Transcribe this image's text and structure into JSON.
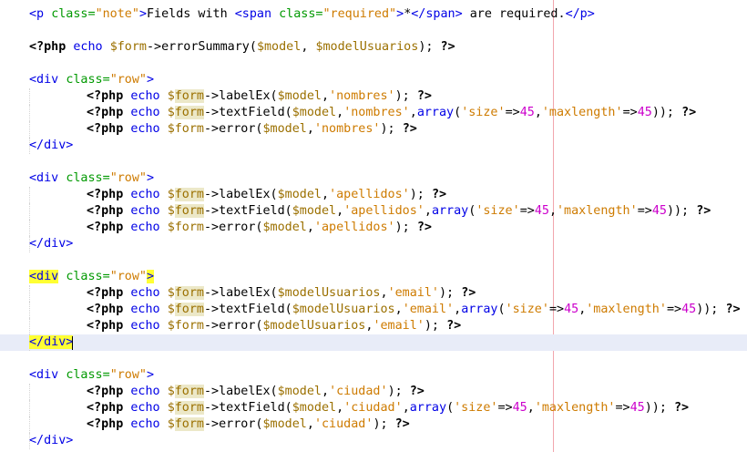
{
  "editor": {
    "lines": [
      {
        "text": "<p class=\"note\">Fields with <span class=\"required\">*</span> are required.</p>",
        "tokens": [
          [
            "t-tag",
            "<p "
          ],
          [
            "t-attr",
            "class="
          ],
          [
            "t-str",
            "\"note\""
          ],
          [
            "t-tag",
            ">"
          ],
          [
            "t-txt",
            "Fields with "
          ],
          [
            "t-tag",
            "<span "
          ],
          [
            "t-attr",
            "class="
          ],
          [
            "t-str",
            "\"required\""
          ],
          [
            "t-tag",
            ">"
          ],
          [
            "t-txt",
            "*"
          ],
          [
            "t-tag",
            "</span>"
          ],
          [
            "t-txt",
            " are required."
          ],
          [
            "t-tag",
            "</p>"
          ]
        ]
      },
      {
        "text": "",
        "tokens": []
      },
      {
        "text": "<?php echo $form->errorSummary($model, $modelUsuarios); ?>",
        "tokens": [
          [
            "t-kw",
            "<?php "
          ],
          [
            "t-fn",
            "echo "
          ],
          [
            "t-var",
            "$form"
          ],
          [
            "t-txt",
            "->errorSummary("
          ],
          [
            "t-var",
            "$model"
          ],
          [
            "t-txt",
            ", "
          ],
          [
            "t-var",
            "$modelUsuarios"
          ],
          [
            "t-txt",
            "); "
          ],
          [
            "t-kw",
            "?>"
          ]
        ]
      },
      {
        "text": "",
        "tokens": []
      },
      {
        "text": "<div class=\"row\">",
        "tokens": [
          [
            "t-tag",
            "<div "
          ],
          [
            "t-attr",
            "class="
          ],
          [
            "t-str",
            "\"row\""
          ],
          [
            "t-tag",
            ">"
          ]
        ]
      },
      {
        "text": "<?php echo $form->labelEx($model,'nombres'); ?>",
        "indent": true,
        "tokens": [
          [
            "t-kw",
            "<?php "
          ],
          [
            "t-fn",
            "echo "
          ],
          [
            "t-var",
            "$"
          ],
          [
            "t-var hl-tan",
            "form"
          ],
          [
            "t-txt",
            "->labelEx("
          ],
          [
            "t-var",
            "$model"
          ],
          [
            "t-txt",
            ","
          ],
          [
            "t-str",
            "'nombres'"
          ],
          [
            "t-txt",
            "); "
          ],
          [
            "t-kw",
            "?>"
          ]
        ]
      },
      {
        "text": "<?php echo $form->textField($model,'nombres',array('size'=>45,'maxlength'=>45)); ?>",
        "indent": true,
        "tokens": [
          [
            "t-kw",
            "<?php "
          ],
          [
            "t-fn",
            "echo "
          ],
          [
            "t-var",
            "$"
          ],
          [
            "t-var hl-tan",
            "form"
          ],
          [
            "t-txt",
            "->textField("
          ],
          [
            "t-var",
            "$model"
          ],
          [
            "t-txt",
            ","
          ],
          [
            "t-str",
            "'nombres'"
          ],
          [
            "t-txt",
            ","
          ],
          [
            "t-arr",
            "array"
          ],
          [
            "t-txt",
            "("
          ],
          [
            "t-str",
            "'size'"
          ],
          [
            "t-txt",
            "=>"
          ],
          [
            "t-num",
            "45"
          ],
          [
            "t-txt",
            ","
          ],
          [
            "t-str",
            "'maxlength'"
          ],
          [
            "t-txt",
            "=>"
          ],
          [
            "t-num",
            "45"
          ],
          [
            "t-txt",
            ")); "
          ],
          [
            "t-kw",
            "?>"
          ]
        ]
      },
      {
        "text": "<?php echo $form->error($model,'nombres'); ?>",
        "indent": true,
        "tokens": [
          [
            "t-kw",
            "<?php "
          ],
          [
            "t-fn",
            "echo "
          ],
          [
            "t-var",
            "$form"
          ],
          [
            "t-txt",
            "->error("
          ],
          [
            "t-var",
            "$model"
          ],
          [
            "t-txt",
            ","
          ],
          [
            "t-str",
            "'nombres'"
          ],
          [
            "t-txt",
            "); "
          ],
          [
            "t-kw",
            "?>"
          ]
        ]
      },
      {
        "text": "</div>",
        "tokens": [
          [
            "t-tag",
            "</div>"
          ]
        ]
      },
      {
        "text": "",
        "tokens": []
      },
      {
        "text": "<div class=\"row\">",
        "tokens": [
          [
            "t-tag",
            "<div "
          ],
          [
            "t-attr",
            "class="
          ],
          [
            "t-str",
            "\"row\""
          ],
          [
            "t-tag",
            ">"
          ]
        ]
      },
      {
        "text": "<?php echo $form->labelEx($model,'apellidos'); ?>",
        "indent": true,
        "tokens": [
          [
            "t-kw",
            "<?php "
          ],
          [
            "t-fn",
            "echo "
          ],
          [
            "t-var",
            "$"
          ],
          [
            "t-var hl-tan",
            "form"
          ],
          [
            "t-txt",
            "->labelEx("
          ],
          [
            "t-var",
            "$model"
          ],
          [
            "t-txt",
            ","
          ],
          [
            "t-str",
            "'apellidos'"
          ],
          [
            "t-txt",
            "); "
          ],
          [
            "t-kw",
            "?>"
          ]
        ]
      },
      {
        "text": "<?php echo $form->textField($model,'apellidos',array('size'=>45,'maxlength'=>45)); ?>",
        "indent": true,
        "tokens": [
          [
            "t-kw",
            "<?php "
          ],
          [
            "t-fn",
            "echo "
          ],
          [
            "t-var",
            "$"
          ],
          [
            "t-var hl-tan",
            "form"
          ],
          [
            "t-txt",
            "->textField("
          ],
          [
            "t-var",
            "$model"
          ],
          [
            "t-txt",
            ","
          ],
          [
            "t-str",
            "'apellidos'"
          ],
          [
            "t-txt",
            ","
          ],
          [
            "t-arr",
            "array"
          ],
          [
            "t-txt",
            "("
          ],
          [
            "t-str",
            "'size'"
          ],
          [
            "t-txt",
            "=>"
          ],
          [
            "t-num",
            "45"
          ],
          [
            "t-txt",
            ","
          ],
          [
            "t-str",
            "'maxlength'"
          ],
          [
            "t-txt",
            "=>"
          ],
          [
            "t-num",
            "45"
          ],
          [
            "t-txt",
            ")); "
          ],
          [
            "t-kw",
            "?>"
          ]
        ]
      },
      {
        "text": "<?php echo $form->error($model,'apellidos'); ?>",
        "indent": true,
        "tokens": [
          [
            "t-kw",
            "<?php "
          ],
          [
            "t-fn",
            "echo "
          ],
          [
            "t-var",
            "$form"
          ],
          [
            "t-txt",
            "->error("
          ],
          [
            "t-var",
            "$model"
          ],
          [
            "t-txt",
            ","
          ],
          [
            "t-str",
            "'apellidos'"
          ],
          [
            "t-txt",
            "); "
          ],
          [
            "t-kw",
            "?>"
          ]
        ]
      },
      {
        "text": "</div>",
        "tokens": [
          [
            "t-tag",
            "</div>"
          ]
        ]
      },
      {
        "text": "",
        "tokens": []
      },
      {
        "text": "<div class=\"row\">",
        "tokens": [
          [
            "t-tag hl-yellow",
            "<div"
          ],
          [
            "t-tag",
            " "
          ],
          [
            "t-attr",
            "class="
          ],
          [
            "t-str",
            "\"row\""
          ],
          [
            "t-tag hl-yellow",
            ">"
          ]
        ]
      },
      {
        "text": "<?php echo $form->labelEx($modelUsuarios,'email'); ?>",
        "indent": true,
        "tokens": [
          [
            "t-kw",
            "<?php "
          ],
          [
            "t-fn",
            "echo "
          ],
          [
            "t-var",
            "$"
          ],
          [
            "t-var hl-tan",
            "form"
          ],
          [
            "t-txt",
            "->labelEx("
          ],
          [
            "t-var",
            "$modelUsuarios"
          ],
          [
            "t-txt",
            ","
          ],
          [
            "t-str",
            "'email'"
          ],
          [
            "t-txt",
            "); "
          ],
          [
            "t-kw",
            "?>"
          ]
        ]
      },
      {
        "text": "<?php echo $form->textField($modelUsuarios,'email',array('size'=>45,'maxlength'=>45)); ?>",
        "indent": true,
        "tokens": [
          [
            "t-kw",
            "<?php "
          ],
          [
            "t-fn",
            "echo "
          ],
          [
            "t-var",
            "$"
          ],
          [
            "t-var hl-tan",
            "form"
          ],
          [
            "t-txt",
            "->textField("
          ],
          [
            "t-var",
            "$modelUsuarios"
          ],
          [
            "t-txt",
            ","
          ],
          [
            "t-str",
            "'email'"
          ],
          [
            "t-txt",
            ","
          ],
          [
            "t-arr",
            "array"
          ],
          [
            "t-txt",
            "("
          ],
          [
            "t-str",
            "'size'"
          ],
          [
            "t-txt",
            "=>"
          ],
          [
            "t-num",
            "45"
          ],
          [
            "t-txt",
            ","
          ],
          [
            "t-str",
            "'maxlength'"
          ],
          [
            "t-txt",
            "=>"
          ],
          [
            "t-num",
            "45"
          ],
          [
            "t-txt",
            ")); "
          ],
          [
            "t-kw",
            "?>"
          ]
        ]
      },
      {
        "text": "<?php echo $form->error($modelUsuarios,'email'); ?>",
        "indent": true,
        "tokens": [
          [
            "t-kw",
            "<?php "
          ],
          [
            "t-fn",
            "echo "
          ],
          [
            "t-var",
            "$form"
          ],
          [
            "t-txt",
            "->error("
          ],
          [
            "t-var",
            "$modelUsuarios"
          ],
          [
            "t-txt",
            ","
          ],
          [
            "t-str",
            "'email'"
          ],
          [
            "t-txt",
            "); "
          ],
          [
            "t-kw",
            "?>"
          ]
        ]
      },
      {
        "text": "</div>",
        "current": true,
        "tokens": [
          [
            "t-tag hl-yellow",
            "</div>"
          ]
        ]
      },
      {
        "text": "",
        "tokens": []
      },
      {
        "text": "<div class=\"row\">",
        "tokens": [
          [
            "t-tag",
            "<div "
          ],
          [
            "t-attr",
            "class="
          ],
          [
            "t-str",
            "\"row\""
          ],
          [
            "t-tag",
            ">"
          ]
        ]
      },
      {
        "text": "<?php echo $form->labelEx($model,'ciudad'); ?>",
        "indent": true,
        "tokens": [
          [
            "t-kw",
            "<?php "
          ],
          [
            "t-fn",
            "echo "
          ],
          [
            "t-var",
            "$"
          ],
          [
            "t-var hl-tan",
            "form"
          ],
          [
            "t-txt",
            "->labelEx("
          ],
          [
            "t-var",
            "$model"
          ],
          [
            "t-txt",
            ","
          ],
          [
            "t-str",
            "'ciudad'"
          ],
          [
            "t-txt",
            "); "
          ],
          [
            "t-kw",
            "?>"
          ]
        ]
      },
      {
        "text": "<?php echo $form->textField($model,'ciudad',array('size'=>45,'maxlength'=>45)); ?>",
        "indent": true,
        "tokens": [
          [
            "t-kw",
            "<?php "
          ],
          [
            "t-fn",
            "echo "
          ],
          [
            "t-var",
            "$"
          ],
          [
            "t-var hl-tan",
            "form"
          ],
          [
            "t-txt",
            "->textField("
          ],
          [
            "t-var",
            "$model"
          ],
          [
            "t-txt",
            ","
          ],
          [
            "t-str",
            "'ciudad'"
          ],
          [
            "t-txt",
            ","
          ],
          [
            "t-arr",
            "array"
          ],
          [
            "t-txt",
            "("
          ],
          [
            "t-str",
            "'size'"
          ],
          [
            "t-txt",
            "=>"
          ],
          [
            "t-num",
            "45"
          ],
          [
            "t-txt",
            ","
          ],
          [
            "t-str",
            "'maxlength'"
          ],
          [
            "t-txt",
            "=>"
          ],
          [
            "t-num",
            "45"
          ],
          [
            "t-txt",
            ")); "
          ],
          [
            "t-kw",
            "?>"
          ]
        ]
      },
      {
        "text": "<?php echo $form->error($model,'ciudad'); ?>",
        "indent": true,
        "tokens": [
          [
            "t-kw",
            "<?php "
          ],
          [
            "t-fn",
            "echo "
          ],
          [
            "t-var",
            "$"
          ],
          [
            "t-var hl-tan",
            "form"
          ],
          [
            "t-txt",
            "->error("
          ],
          [
            "t-var",
            "$model"
          ],
          [
            "t-txt",
            ","
          ],
          [
            "t-str",
            "'ciudad'"
          ],
          [
            "t-txt",
            "); "
          ],
          [
            "t-kw",
            "?>"
          ]
        ]
      },
      {
        "text": "</div>",
        "tokens": [
          [
            "t-tag",
            "</div>"
          ]
        ]
      }
    ]
  },
  "colors": {
    "tag": "#0000e6",
    "attribute": "#009900",
    "string": "#ce7b00",
    "number": "#cc00cc",
    "variable": "#9b7000",
    "bracket_match_highlight": "#ffff33",
    "occurrence_highlight": "#ece8c8",
    "current_line": "#e8ecf8",
    "right_margin": "#f2a6ae"
  }
}
